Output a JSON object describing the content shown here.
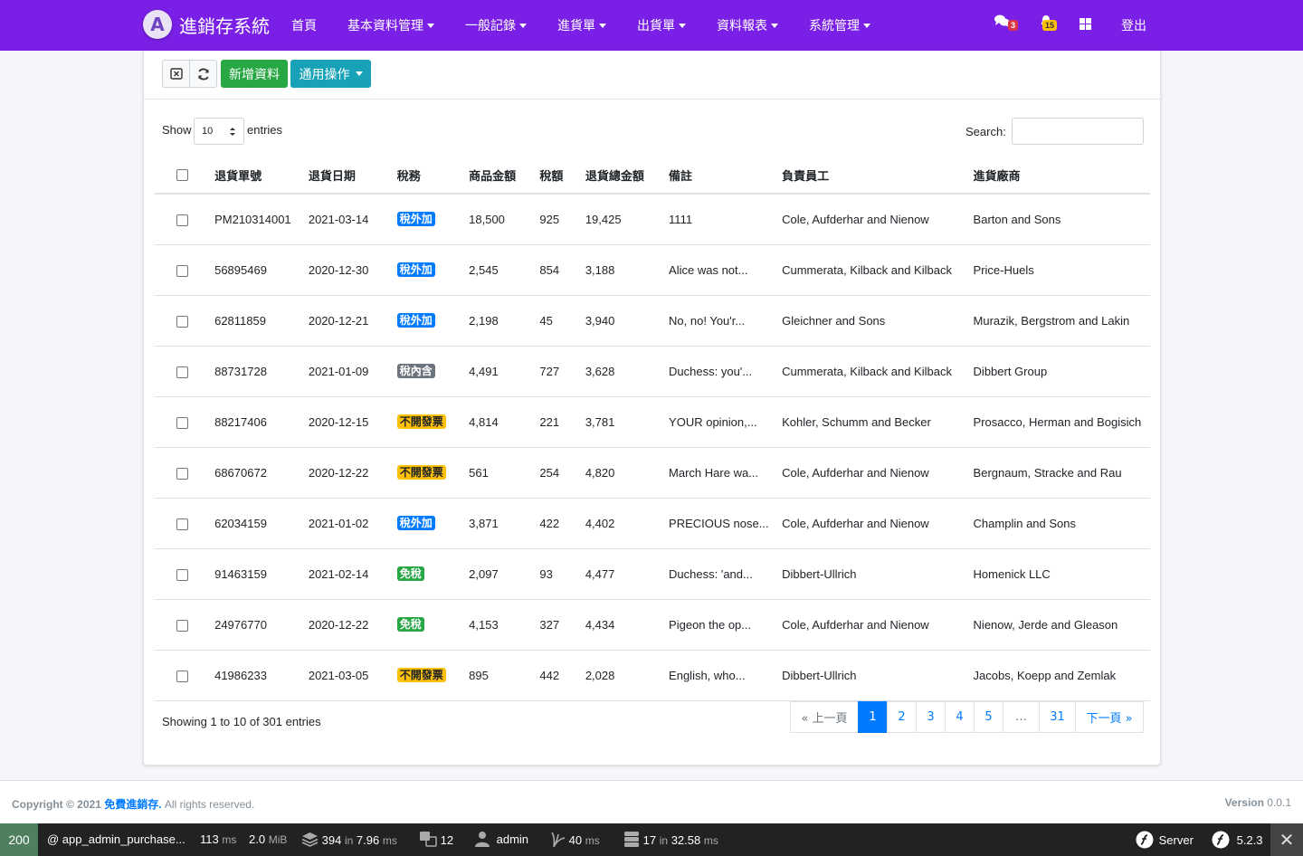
{
  "navbar": {
    "brand_letter": "A",
    "brand": "進銷存系統",
    "items": [
      {
        "label": "首頁",
        "dropdown": false
      },
      {
        "label": "基本資料管理",
        "dropdown": true
      },
      {
        "label": "一般記錄",
        "dropdown": true
      },
      {
        "label": "進貨單",
        "dropdown": true
      },
      {
        "label": "出貨單",
        "dropdown": true
      },
      {
        "label": "資料報表",
        "dropdown": true
      },
      {
        "label": "系統管理",
        "dropdown": true
      }
    ],
    "messages_count": "3",
    "notifications_count": "15",
    "logout": "登出",
    "icons": [
      "comments-icon",
      "bell-icon",
      "th-large-icon"
    ]
  },
  "toolbar": {
    "clear_icon": "window-close-icon",
    "refresh_icon": "sync-icon",
    "add_label": "新增資料",
    "actions_label": "通用操作"
  },
  "table_controls": {
    "show_label": "Show",
    "page_length": "10",
    "entries_label": "entries",
    "search_label": "Search:"
  },
  "table": {
    "columns": [
      "退貨單號",
      "退貨日期",
      "稅務",
      "商品金額",
      "稅額",
      "退貨總金額",
      "備註",
      "負責員工",
      "進貨廠商"
    ],
    "rows": [
      {
        "no": "PM210314001",
        "date": "2021-03-14",
        "tax": "稅外加",
        "tax_color": "#007bff",
        "amount": "18,500",
        "tax_amt": "925",
        "total": "19,425",
        "note": "1111",
        "staff": "Cole, Aufderhar and Nienow",
        "vendor": "Barton and Sons"
      },
      {
        "no": "56895469",
        "date": "2020-12-30",
        "tax": "稅外加",
        "tax_color": "#007bff",
        "amount": "2,545",
        "tax_amt": "854",
        "total": "3,188",
        "note": "Alice was not...",
        "staff": "Cummerata, Kilback and Kilback",
        "vendor": "Price-Huels"
      },
      {
        "no": "62811859",
        "date": "2020-12-21",
        "tax": "稅外加",
        "tax_color": "#007bff",
        "amount": "2,198",
        "tax_amt": "45",
        "total": "3,940",
        "note": "No, no! You'r...",
        "staff": "Gleichner and Sons",
        "vendor": "Murazik, Bergstrom and Lakin"
      },
      {
        "no": "88731728",
        "date": "2021-01-09",
        "tax": "稅內含",
        "tax_color": "#6c757d",
        "amount": "4,491",
        "tax_amt": "727",
        "total": "3,628",
        "note": "Duchess: you'...",
        "staff": "Cummerata, Kilback and Kilback",
        "vendor": "Dibbert Group"
      },
      {
        "no": "88217406",
        "date": "2020-12-15",
        "tax": "不開發票",
        "tax_color": "#ffc107",
        "amount": "4,814",
        "tax_amt": "221",
        "total": "3,781",
        "note": "YOUR opinion,...",
        "staff": "Kohler, Schumm and Becker",
        "vendor": "Prosacco, Herman and Bogisich"
      },
      {
        "no": "68670672",
        "date": "2020-12-22",
        "tax": "不開發票",
        "tax_color": "#ffc107",
        "amount": "561",
        "tax_amt": "254",
        "total": "4,820",
        "note": "March Hare wa...",
        "staff": "Cole, Aufderhar and Nienow",
        "vendor": "Bergnaum, Stracke and Rau"
      },
      {
        "no": "62034159",
        "date": "2021-01-02",
        "tax": "稅外加",
        "tax_color": "#007bff",
        "amount": "3,871",
        "tax_amt": "422",
        "total": "4,402",
        "note": "PRECIOUS nose...",
        "staff": "Cole, Aufderhar and Nienow",
        "vendor": "Champlin and Sons"
      },
      {
        "no": "91463159",
        "date": "2021-02-14",
        "tax": "免稅",
        "tax_color": "#28a745",
        "amount": "2,097",
        "tax_amt": "93",
        "total": "4,477",
        "note": "Duchess: 'and...",
        "staff": "Dibbert-Ullrich",
        "vendor": "Homenick LLC"
      },
      {
        "no": "24976770",
        "date": "2020-12-22",
        "tax": "免稅",
        "tax_color": "#28a745",
        "amount": "4,153",
        "tax_amt": "327",
        "total": "4,434",
        "note": "Pigeon the op...",
        "staff": "Cole, Aufderhar and Nienow",
        "vendor": "Nienow, Jerde and Gleason"
      },
      {
        "no": "41986233",
        "date": "2021-03-05",
        "tax": "不開發票",
        "tax_color": "#ffc107",
        "amount": "895",
        "tax_amt": "442",
        "total": "2,028",
        "note": "English, who...",
        "staff": "Dibbert-Ullrich",
        "vendor": "Jacobs, Koepp and Zemlak"
      }
    ]
  },
  "info": "Showing 1 to 10 of 301 entries",
  "pagination": {
    "prev": "« 上一頁",
    "pages": [
      "1",
      "2",
      "3",
      "4",
      "5",
      "…",
      "31"
    ],
    "active": "1",
    "next": "下一頁 »"
  },
  "footer": {
    "copyright_prefix": "Copyright © 2021",
    "site": "免費進銷存.",
    "rights": "All rights reserved.",
    "version_label": "Version",
    "version": "0.0.1"
  },
  "debug_toolbar": {
    "status": "200",
    "route": "@ app_admin_purchase...",
    "time": "113",
    "time_unit": "ms",
    "memory": "2.0",
    "memory_unit": "MiB",
    "events": "394",
    "events_in": "in",
    "events_time": "7.96",
    "events_unit": "ms",
    "translations": "12",
    "user": "admin",
    "twig": "40",
    "twig_unit": "ms",
    "db": "17",
    "db_in": "in",
    "db_time": "32.58",
    "db_unit": "ms",
    "server": "Server",
    "version": "5.2.3"
  }
}
